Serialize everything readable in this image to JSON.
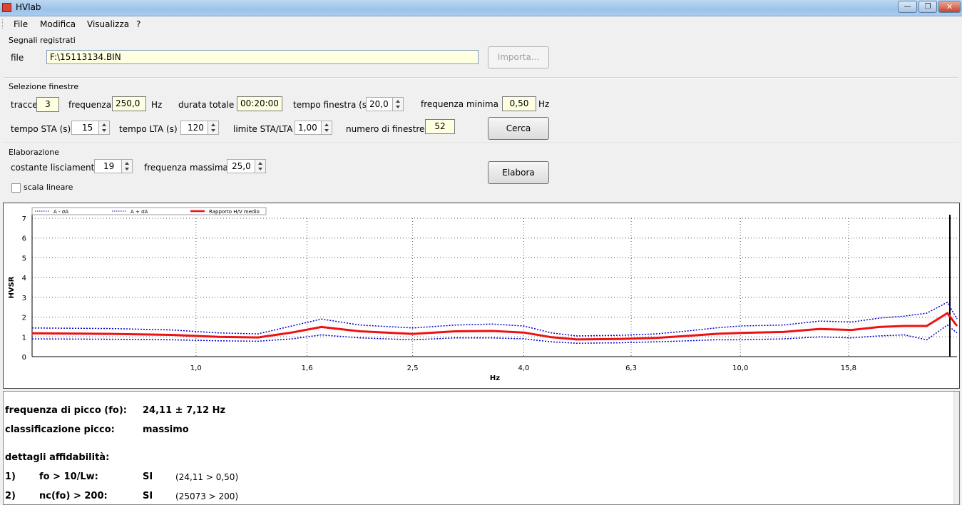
{
  "window": {
    "title": "HVlab"
  },
  "menu": [
    "File",
    "Modifica",
    "Visualizza",
    "?"
  ],
  "segnali": {
    "group_label": "Segnali registrati",
    "file_label": "file",
    "file_value": "F:\\15113134.BIN",
    "import_button": "Importa..."
  },
  "selezione": {
    "group_label": "Selezione finestre",
    "tracce_label": "tracce",
    "tracce_value": "3",
    "frequenza_label": "frequenza",
    "frequenza_value": "250,0",
    "frequenza_unit": "Hz",
    "durata_label": "durata totale",
    "durata_value": "00:20:00",
    "tempo_finestra_label": "tempo finestra (s)",
    "tempo_finestra_value": "20,0",
    "freq_minima_label": "frequenza minima",
    "freq_minima_value": "0,50",
    "freq_minima_unit": "Hz",
    "sta_label": "tempo STA (s)",
    "sta_value": "15",
    "lta_label": "tempo LTA (s)",
    "lta_value": "120",
    "limite_label": "limite STA/LTA",
    "limite_value": "1,00",
    "num_finestre_label": "numero di  finestre",
    "num_finestre_value": "52",
    "cerca_button": "Cerca"
  },
  "elaborazione": {
    "group_label": "Elaborazione",
    "costante_label": "costante lisciamento:",
    "costante_value": "19",
    "freq_massima_label": "frequenza massima",
    "freq_massima_value": "25,0",
    "elabora_button": "Elabora",
    "scala_label": "scala lineare",
    "scala_checked": false
  },
  "chart_data": {
    "type": "line",
    "xlabel": "Hz",
    "ylabel": "HVSR",
    "ylim": [
      0,
      7
    ],
    "y_ticks": [
      "0",
      "1",
      "2",
      "3",
      "4",
      "5",
      "6",
      "7"
    ],
    "x_ticks": [
      "1,0",
      "1,6",
      "2,5",
      "4,0",
      "6,3",
      "10,0",
      "15,8"
    ],
    "x_scale": "log",
    "legend_position": "top-left",
    "grid": true,
    "series": [
      {
        "name": "A - σA",
        "color": "#0000cc",
        "style": "dotted",
        "x": [
          0.5,
          0.7,
          0.9,
          1.1,
          1.3,
          1.5,
          1.7,
          2.0,
          2.5,
          3.0,
          3.5,
          4.0,
          4.5,
          5.0,
          6.0,
          7.0,
          8.0,
          9.0,
          10.0,
          12.0,
          14.0,
          16.0,
          18.0,
          20.0,
          22.0,
          24.0,
          25.0
        ],
        "y": [
          0.9,
          0.88,
          0.85,
          0.8,
          0.78,
          0.9,
          1.1,
          0.95,
          0.85,
          0.95,
          0.95,
          0.9,
          0.75,
          0.68,
          0.7,
          0.75,
          0.8,
          0.85,
          0.85,
          0.9,
          1.0,
          0.95,
          1.05,
          1.1,
          0.85,
          1.6,
          1.2
        ]
      },
      {
        "name": "A + σA",
        "color": "#0000cc",
        "style": "dotted",
        "x": [
          0.5,
          0.7,
          0.9,
          1.1,
          1.3,
          1.5,
          1.7,
          2.0,
          2.5,
          3.0,
          3.5,
          4.0,
          4.5,
          5.0,
          6.0,
          7.0,
          8.0,
          9.0,
          10.0,
          12.0,
          14.0,
          16.0,
          18.0,
          20.0,
          22.0,
          24.0,
          25.0
        ],
        "y": [
          1.45,
          1.42,
          1.35,
          1.2,
          1.15,
          1.55,
          1.9,
          1.6,
          1.45,
          1.6,
          1.65,
          1.55,
          1.2,
          1.05,
          1.08,
          1.15,
          1.3,
          1.45,
          1.55,
          1.6,
          1.8,
          1.75,
          1.95,
          2.05,
          2.2,
          2.75,
          1.9
        ]
      },
      {
        "name": "Rapporto H/V medio",
        "color": "#ee1111",
        "style": "solid",
        "x": [
          0.5,
          0.7,
          0.9,
          1.1,
          1.3,
          1.5,
          1.7,
          2.0,
          2.5,
          3.0,
          3.5,
          4.0,
          4.5,
          5.0,
          6.0,
          7.0,
          8.0,
          9.0,
          10.0,
          12.0,
          14.0,
          16.0,
          18.0,
          20.0,
          22.0,
          24.0,
          25.0
        ],
        "y": [
          1.18,
          1.15,
          1.1,
          1.0,
          0.97,
          1.22,
          1.5,
          1.28,
          1.15,
          1.28,
          1.3,
          1.22,
          0.98,
          0.87,
          0.89,
          0.95,
          1.05,
          1.15,
          1.2,
          1.25,
          1.4,
          1.35,
          1.5,
          1.55,
          1.55,
          2.2,
          1.55
        ]
      }
    ]
  },
  "results": {
    "picco_label": "frequenza di picco (fo):",
    "picco_value": "24,11 ± 7,12 Hz",
    "classificazione_label": "classificazione picco:",
    "classificazione_value": "massimo",
    "dettagli_label": "dettagli affidabilità:",
    "rows": [
      {
        "num": "1)",
        "crit": "fo > 10/Lw:",
        "res": "SI",
        "detail": "(24,11 > 0,50)"
      },
      {
        "num": "2)",
        "crit": "nc(fo) > 200:",
        "res": "SI",
        "detail": "(25073 > 200)"
      }
    ]
  }
}
